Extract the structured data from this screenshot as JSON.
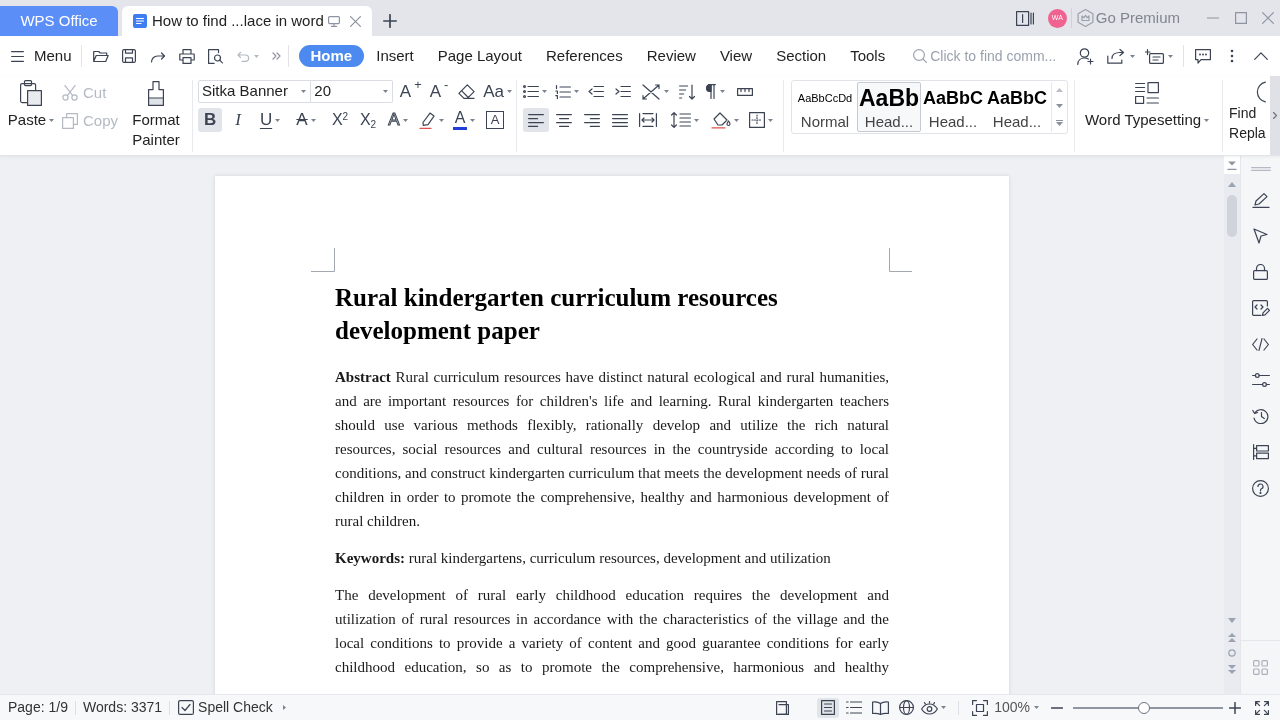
{
  "title_bar": {
    "tabs": [
      {
        "label": "WPS Office",
        "kind": "home",
        "selected": false
      },
      {
        "label": "How to find ...lace in word",
        "kind": "document",
        "selected": true
      }
    ],
    "avatar": "WA",
    "premium": "Go Premium"
  },
  "menu_bar": {
    "menu": "Menu",
    "undo": {
      "disabled": true
    },
    "tabs": [
      {
        "label": "Home",
        "selected": true
      },
      {
        "label": "Insert",
        "selected": false
      },
      {
        "label": "Page Layout",
        "selected": false
      },
      {
        "label": "References",
        "selected": false
      },
      {
        "label": "Review",
        "selected": false
      },
      {
        "label": "View",
        "selected": false
      },
      {
        "label": "Section",
        "selected": false
      },
      {
        "label": "Tools",
        "selected": false
      }
    ],
    "search": {
      "placeholder": "Click to find comm..."
    }
  },
  "ribbon": {
    "clipboard": {
      "paste": "Paste",
      "cut": {
        "label": "Cut",
        "disabled": true
      },
      "copy": {
        "label": "Copy",
        "disabled": true
      },
      "format_painter": "Format Painter"
    },
    "font": {
      "name": "Sitka Banner",
      "size": "20",
      "size_tools": [
        {
          "kind": "grow",
          "glyph": "A$^{+}$"
        },
        {
          "kind": "shrink",
          "glyph": "A$^{-}$"
        },
        {
          "kind": "clear"
        },
        {
          "kind": "case",
          "glyph": "Aa"
        }
      ],
      "formats": [
        {
          "kind": "bold",
          "glyph": "B",
          "on": true
        },
        {
          "kind": "italic",
          "glyph": "I",
          "on": false
        },
        {
          "kind": "underline",
          "glyph": "U",
          "on": false
        },
        {
          "kind": "strikethrough",
          "glyph": "A",
          "on": false
        },
        {
          "kind": "superscript",
          "glyph": "X$^{2}$",
          "on": false
        },
        {
          "kind": "subscript",
          "glyph": "X$_{2}$",
          "on": false
        },
        {
          "kind": "effect",
          "glyph": "A",
          "on": false
        },
        {
          "kind": "highlight",
          "on": false
        },
        {
          "kind": "color",
          "glyph": "A",
          "color": "#1f3fd8",
          "on": false
        },
        {
          "kind": "border",
          "glyph": "A",
          "on": false
        }
      ]
    },
    "paragraph": {
      "alignment": [
        {
          "kind": "left",
          "selected": true
        },
        {
          "kind": "center",
          "selected": false
        },
        {
          "kind": "right",
          "selected": false
        },
        {
          "kind": "justify",
          "selected": false
        },
        {
          "kind": "distributed",
          "selected": false
        }
      ]
    },
    "styles": [
      {
        "kind": "normal",
        "preview": "AaBbCcDd",
        "label": "Normal",
        "selected": false
      },
      {
        "kind": "heading1",
        "preview": "AaBb",
        "label": "Head...",
        "selected": true
      },
      {
        "kind": "heading2",
        "preview": "AaBbC",
        "label": "Head...",
        "selected": false
      },
      {
        "kind": "heading3",
        "preview": "AaBbC",
        "label": "Head...",
        "selected": false
      }
    ],
    "typesetting": "Word Typesetting",
    "find_replace": [
      "Find",
      "Repla"
    ]
  },
  "document": {
    "title": "Rural kindergarten curriculum resources development paper",
    "paragraphs": [
      {
        "text": "**Abstract** Rural curriculum resources have distinct natural ecological and rural humanities, and are important resources for children's life and learning. Rural kindergarten teachers should use various methods flexibly, rationally develop and utilize the rich natural resources, social resources and cultural resources in the countryside according to local conditions, and construct kindergarten curriculum that meets the development needs of rural children in order to promote the comprehensive, healthy and harmonious development of rural children.",
        "continues": false
      },
      {
        "text": "**Keywords:** rural kindergartens, curriculum resources, development and utilization",
        "continues": false
      },
      {
        "text": "The development of rural early childhood education requires the development and utilization of rural resources in accordance with the characteristics of the village and the local conditions to provide a variety of content and good guarantee conditions for early childhood education, so as to promote the comprehensive, harmonious and healthy",
        "continues": true
      }
    ]
  },
  "status_bar": {
    "page": "Page: 1/9",
    "words": "Words: 3371",
    "spell_check": "Spell Check",
    "views": [
      {
        "kind": "page",
        "selected": true
      },
      {
        "kind": "outline",
        "selected": false
      },
      {
        "kind": "reading",
        "selected": false
      },
      {
        "kind": "web",
        "selected": false
      }
    ],
    "zoom": "100%",
    "zoom_slider": {
      "level": 0.47
    }
  }
}
